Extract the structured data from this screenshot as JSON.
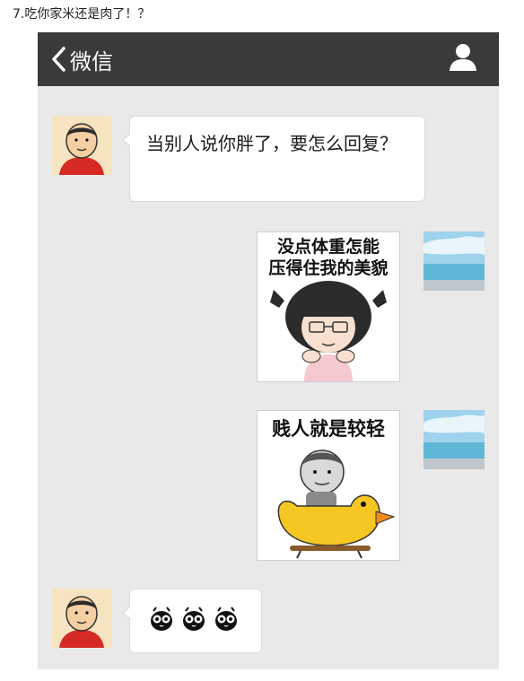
{
  "caption": "7.吃你家米还是肉了！？",
  "header": {
    "back_label": "微信"
  },
  "messages": {
    "m1": "当别人说你胖了，要怎么回复？",
    "m2_line1": "没点体重怎能",
    "m2_line2": "压得住我的美貌",
    "m3": "贱人就是较轻"
  },
  "colors": {
    "topbar": "#3a3a3a",
    "chat_bg": "#e9e9e9",
    "bubble": "#ffffff"
  },
  "icons": [
    "chevron-left-icon",
    "profile-icon",
    "owl-emoji-icon"
  ]
}
